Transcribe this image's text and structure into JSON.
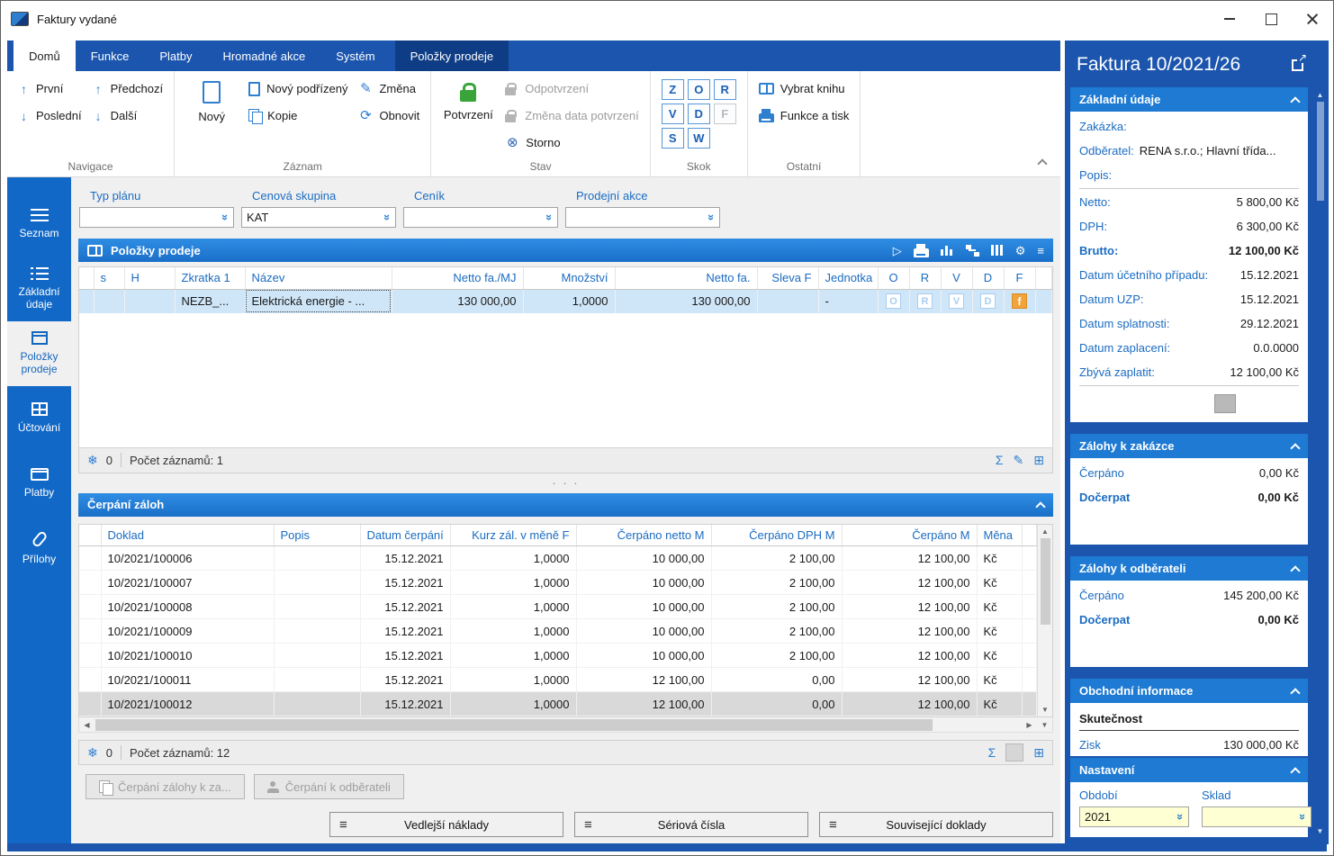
{
  "icons": {
    "sum": "Σ",
    "edit": "✎",
    "snowflake": "❄",
    "refresh": "⟳",
    "storno": "⊗",
    "gear": "⚙",
    "menu": "≡",
    "play": "▷",
    "up": "↑",
    "down": "↓",
    "scroll_up": "▲",
    "scroll_down": "▼",
    "scroll_left": "◀",
    "scroll_right": "▶",
    "dropdown": "»",
    "add_record": "⊞",
    "dots": "· · ·"
  },
  "window": {
    "title": "Faktury vydané"
  },
  "tabs": [
    {
      "label": "Domů"
    },
    {
      "label": "Funkce"
    },
    {
      "label": "Platby"
    },
    {
      "label": "Hromadné akce"
    },
    {
      "label": "Systém"
    },
    {
      "label": "Položky prodeje"
    }
  ],
  "ribbon": {
    "navigace": {
      "label": "Navigace",
      "prvni": "První",
      "posledni": "Poslední",
      "predchozi": "Předchozí",
      "dalsi": "Další"
    },
    "zaznam": {
      "label": "Záznam",
      "novy": "Nový",
      "novy_podrizeny": "Nový podřízený",
      "kopie": "Kopie",
      "zmena": "Změna",
      "obnovit": "Obnovit"
    },
    "stav": {
      "label": "Stav",
      "potvrzeni": "Potvrzení",
      "odpotvrzeni": "Odpotvrzení",
      "zmena_data": "Změna data potvrzení",
      "storno": "Storno"
    },
    "skok": {
      "label": "Skok",
      "keys": [
        "Z",
        "O",
        "R",
        "V",
        "D",
        "F",
        "S",
        "W"
      ]
    },
    "ostatni": {
      "label": "Ostatní",
      "vybrat_knihu": "Vybrat knihu",
      "funkce_tisk": "Funkce a tisk"
    }
  },
  "sidebar": {
    "items": [
      {
        "label": "Seznam"
      },
      {
        "label": "Základní údaje"
      },
      {
        "label": "Položky prodeje"
      },
      {
        "label": "Účtování"
      },
      {
        "label": "Platby"
      },
      {
        "label": "Přílohy"
      }
    ]
  },
  "filters": {
    "typ_planu": {
      "label": "Typ plánu",
      "value": ""
    },
    "cenova_skupina": {
      "label": "Cenová skupina",
      "value": "KAT"
    },
    "cenik": {
      "label": "Ceník",
      "value": ""
    },
    "prodejni_akce": {
      "label": "Prodejní akce",
      "value": ""
    }
  },
  "polozky": {
    "title": "Položky prodeje",
    "headers": [
      "s",
      "H",
      "Zkratka 1",
      "Název",
      "Netto fa./MJ",
      "Množství",
      "Netto fa.",
      "Sleva F",
      "Jednotka",
      "O",
      "R",
      "V",
      "D",
      "F"
    ],
    "row": {
      "zkratka": "NEZB_...",
      "nazev": "Elektrická energie - ...",
      "netto_mj": "130 000,00",
      "mnozstvi": "1,0000",
      "netto_fa": "130 000,00",
      "sleva": "",
      "jednotka": "-",
      "flag_o": "O",
      "flag_r": "R",
      "flag_v": "V",
      "flag_d": "D",
      "flag_f": "f"
    },
    "footer": {
      "records": "0",
      "count": "Počet záznamů: 1"
    }
  },
  "cerpani": {
    "title": "Čerpání záloh",
    "headers": [
      "Doklad",
      "Popis",
      "Datum čerpání",
      "Kurz zál. v měně F",
      "Čerpáno netto M",
      "Čerpáno DPH M",
      "Čerpáno M",
      "Měna"
    ],
    "rows": [
      [
        "10/2021/100006",
        "",
        "15.12.2021",
        "1,0000",
        "10 000,00",
        "2 100,00",
        "12 100,00",
        "Kč"
      ],
      [
        "10/2021/100007",
        "",
        "15.12.2021",
        "1,0000",
        "10 000,00",
        "2 100,00",
        "12 100,00",
        "Kč"
      ],
      [
        "10/2021/100008",
        "",
        "15.12.2021",
        "1,0000",
        "10 000,00",
        "2 100,00",
        "12 100,00",
        "Kč"
      ],
      [
        "10/2021/100009",
        "",
        "15.12.2021",
        "1,0000",
        "10 000,00",
        "2 100,00",
        "12 100,00",
        "Kč"
      ],
      [
        "10/2021/100010",
        "",
        "15.12.2021",
        "1,0000",
        "10 000,00",
        "2 100,00",
        "12 100,00",
        "Kč"
      ],
      [
        "10/2021/100011",
        "",
        "15.12.2021",
        "1,0000",
        "12 100,00",
        "0,00",
        "12 100,00",
        "Kč"
      ],
      [
        "10/2021/100012",
        "",
        "15.12.2021",
        "1,0000",
        "12 100,00",
        "0,00",
        "12 100,00",
        "Kč"
      ]
    ],
    "footer": {
      "records": "0",
      "count": "Počet záznamů: 12"
    },
    "actions": {
      "zaloha_k_zakazce": "Čerpání zálohy k za...",
      "cerpani_k_odberateli": "Čerpání k odběrateli"
    }
  },
  "bottom_buttons": {
    "vedlejsi": "Vedlejší náklady",
    "seriova": "Sériová čísla",
    "souvisejici": "Související doklady"
  },
  "detail": {
    "title": "Faktura 10/2021/26",
    "zakladni": {
      "title": "Základní údaje",
      "rows": [
        {
          "label": "Zakázka:",
          "value": ""
        },
        {
          "label": "Odběratel:",
          "value": "RENA s.r.o.; Hlavní třída..."
        },
        {
          "label": "Popis:",
          "value": ""
        },
        {
          "label": "Netto:",
          "value": "5 800,00 Kč"
        },
        {
          "label": "DPH:",
          "value": "6 300,00 Kč"
        },
        {
          "label": "Brutto:",
          "value": "12 100,00 Kč"
        },
        {
          "label": "Datum účetního případu:",
          "value": "15.12.2021"
        },
        {
          "label": "Datum UZP:",
          "value": "15.12.2021"
        },
        {
          "label": "Datum splatnosti:",
          "value": "29.12.2021"
        },
        {
          "label": "Datum zaplacení:",
          "value": "0.0.0000"
        },
        {
          "label": "Zbývá zaplatit:",
          "value": "12 100,00 Kč"
        }
      ]
    },
    "zalohy_zakazka": {
      "title": "Zálohy k zakázce",
      "rows": [
        {
          "label": "Čerpáno",
          "value": "0,00 Kč"
        },
        {
          "label": "Dočerpat",
          "value": "0,00 Kč"
        }
      ]
    },
    "zalohy_odberatel": {
      "title": "Zálohy k odběrateli",
      "rows": [
        {
          "label": "Čerpáno",
          "value": "145 200,00 Kč"
        },
        {
          "label": "Dočerpat",
          "value": "0,00 Kč"
        }
      ]
    },
    "obchodni": {
      "title": "Obchodní informace",
      "column": "Skutečnost",
      "partial_row": {
        "label": "Zisk",
        "value": "130 000,00 Kč"
      }
    },
    "nastaveni": {
      "title": "Nastavení",
      "obdobi_label": "Období",
      "obdobi_value": "2021",
      "sklad_label": "Sklad",
      "sklad_value": ""
    }
  }
}
